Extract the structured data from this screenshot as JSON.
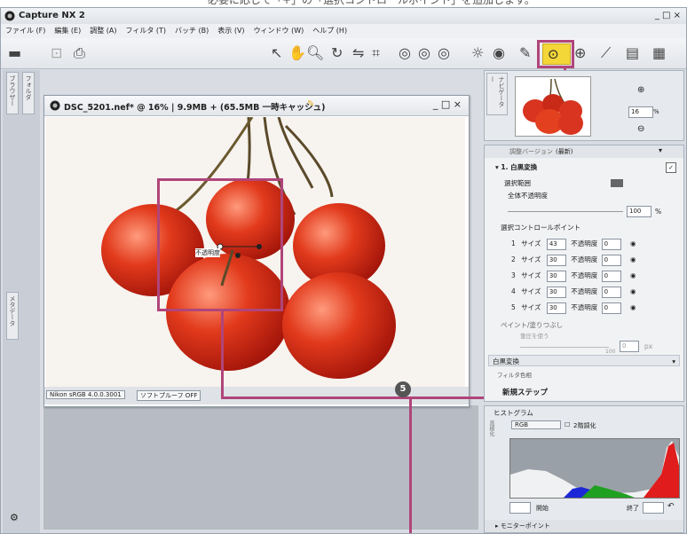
{
  "caption": "必要に応じて「+」の「選択コントロールポイント」を追加します。",
  "app": {
    "title": "Capture NX 2",
    "window_controls": "_ □ ×",
    "menu": [
      "ファイル (F)",
      "編集 (E)",
      "調整 (A)",
      "フィルタ (T)",
      "バッチ (B)",
      "表示 (V)",
      "ウィンドウ (W)",
      "ヘルプ (H)"
    ]
  },
  "left_tabs": [
    "ブラウザー",
    "フォルダ",
    "メタデータ"
  ],
  "document": {
    "title": "DSC_5201.nef* @ 16% | 9.9MB + (65.5MB 一時キャッシュ)",
    "window_controls": "_ □ ×",
    "profile": "Nikon sRGB 4.0.0.3001",
    "softproof": "ソフトプルーフ OFF",
    "control_point_label": "不透明度"
  },
  "navigator": {
    "tab": "ナビゲーター",
    "zoom_value": "16",
    "zoom_unit": "%"
  },
  "edit_list": {
    "tab": "エディットリスト",
    "base_label": "調整バージョン",
    "version": "(最新)",
    "step_title": "1. 白黒変換",
    "selection_range": "選択範囲",
    "overall_opacity": "全体不透明度",
    "overall_value": "100",
    "percent": "%",
    "scp_header": "選択コントロールポイント",
    "points": [
      {
        "n": "1",
        "label": "サイズ",
        "size": "43",
        "opacity_label": "不透明度",
        "opacity": "0"
      },
      {
        "n": "2",
        "label": "サイズ",
        "size": "30",
        "opacity_label": "不透明度",
        "opacity": "0"
      },
      {
        "n": "3",
        "label": "サイズ",
        "size": "30",
        "opacity_label": "不透明度",
        "opacity": "0"
      },
      {
        "n": "4",
        "label": "サイズ",
        "size": "30",
        "opacity_label": "不透明度",
        "opacity": "0"
      },
      {
        "n": "5",
        "label": "サイズ",
        "size": "30",
        "opacity_label": "不透明度",
        "opacity": "0"
      }
    ],
    "paint": "ペイント/塗りつぶし",
    "brush_size": "筆圧を使う",
    "brush_value": "0",
    "brush_max": "100",
    "brush_unit": "px",
    "bw": "白黒変換",
    "filter_color": "フィルタ色相",
    "new_step": "新規ステップ"
  },
  "histogram": {
    "tab": "ヒストグラム",
    "channel": "RGB",
    "mode": "2階調化",
    "start_label": "開始",
    "end_label": "終了",
    "monitor_point": "モニターポイント"
  },
  "badge": "5",
  "colors": {
    "accent": "#b0457a",
    "highlight_icon": "#f3d638"
  }
}
